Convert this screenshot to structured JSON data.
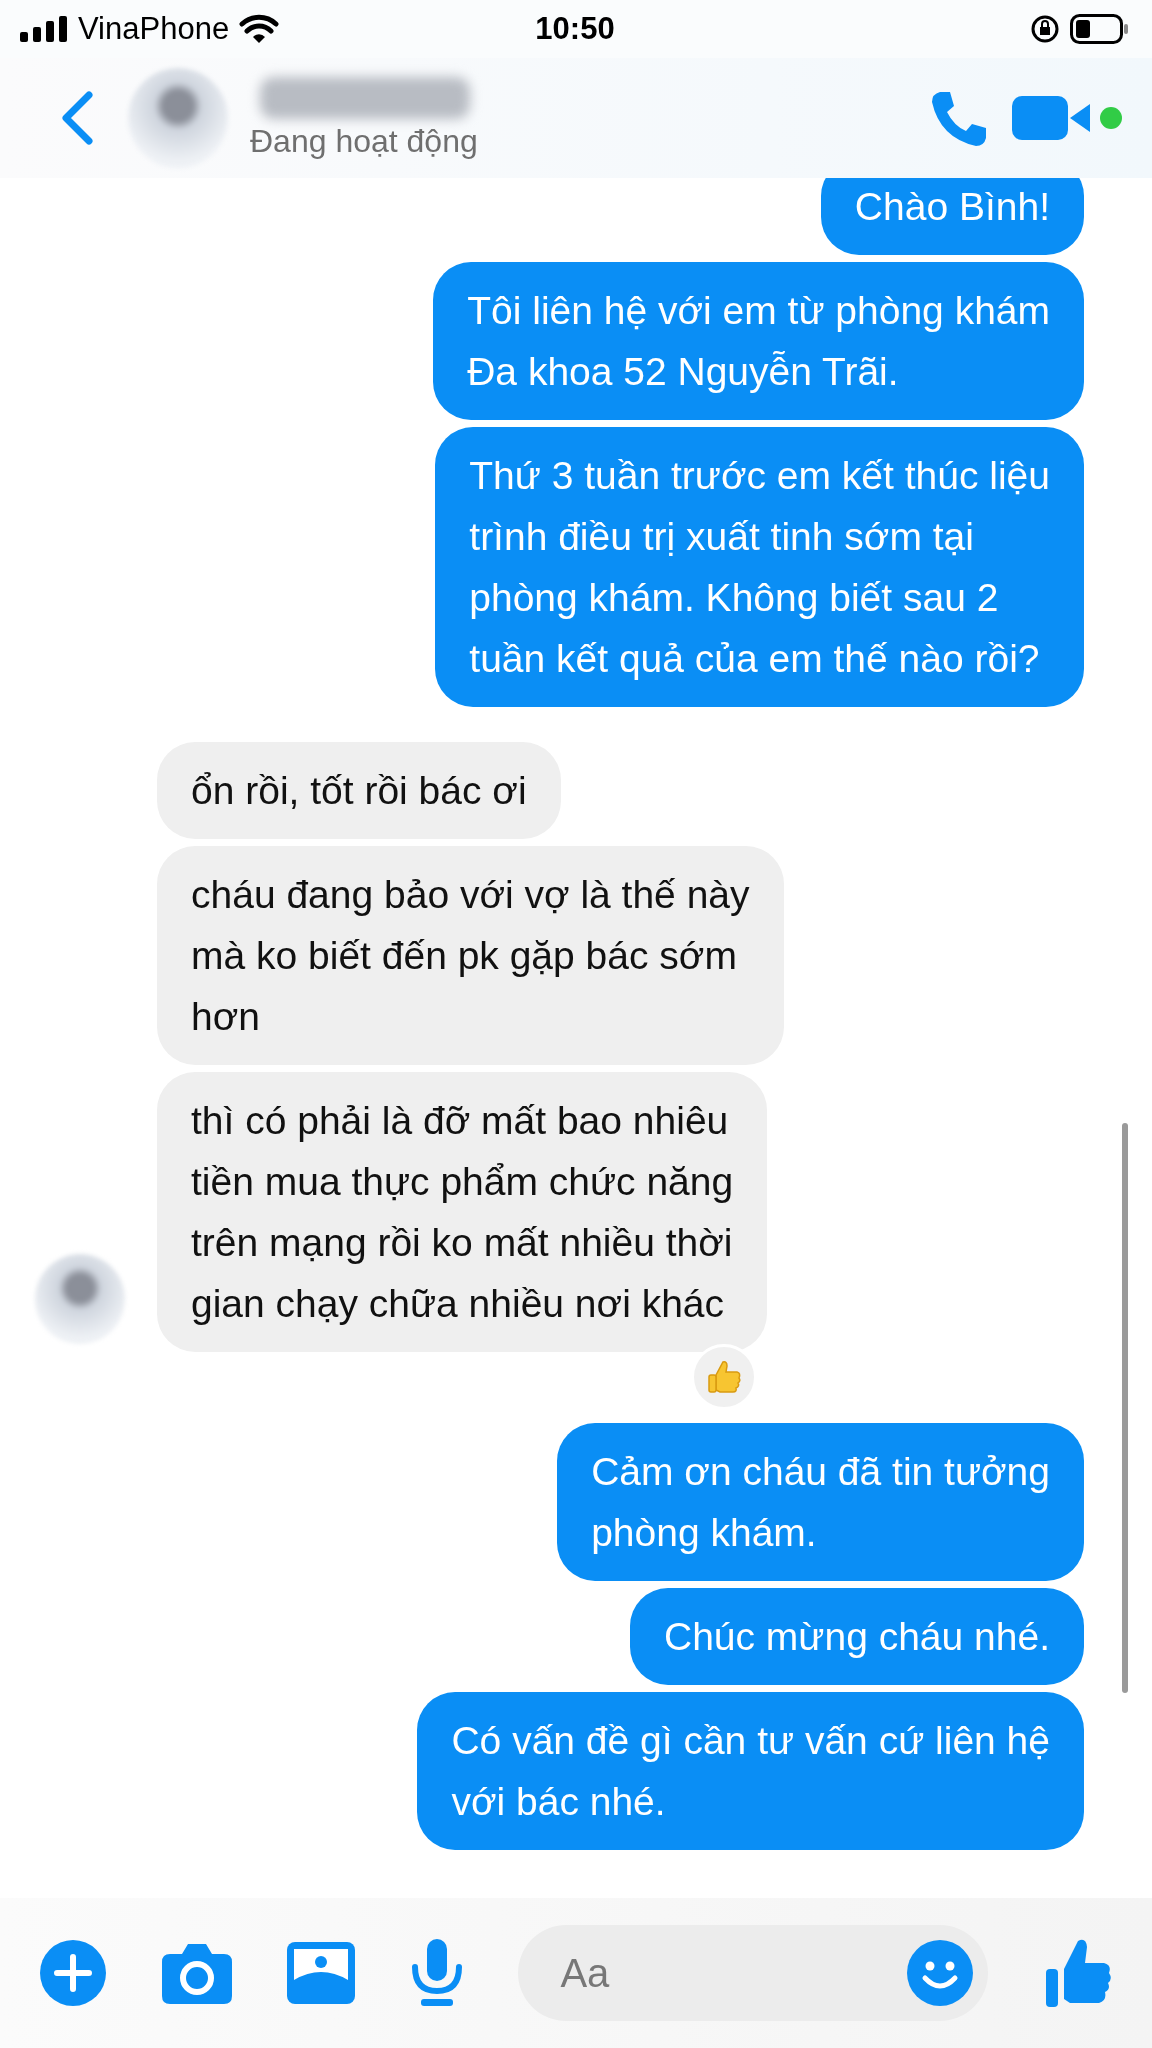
{
  "status_bar": {
    "carrier": "VinaPhone",
    "time": "10:50"
  },
  "header": {
    "presence": "Đang hoạt động"
  },
  "groups": [
    {
      "kind": "outgoing",
      "messages": [
        {
          "text": "Chào Bình!",
          "reacted": false
        },
        {
          "text": "Tôi liên hệ với em từ phòng khám\nĐa khoa 52 Nguyễn Trãi.",
          "reacted": false
        },
        {
          "text": "Thứ 3 tuần trước em kết thúc liệu\ntrình điều trị xuất tinh sớm tại\nphòng khám. Không biết sau 2\ntuần kết quả của em thế nào rồi?",
          "reacted": false
        }
      ]
    },
    {
      "kind": "incoming",
      "messages": [
        {
          "text": "ổn rồi, tốt rồi bác ơi",
          "reacted": false
        },
        {
          "text": "cháu đang bảo với vợ là thế này\nmà ko biết đến pk gặp bác sớm\nhơn",
          "reacted": false
        },
        {
          "text": "thì có phải là đỡ mất bao nhiêu\ntiền mua thực phẩm chức năng\ntrên mạng rồi ko mất nhiều thời\ngian chạy chữa nhiều nơi khác",
          "reacted": true
        }
      ]
    },
    {
      "kind": "outgoing",
      "messages": [
        {
          "text": "Cảm ơn cháu đã tin tưởng\nphòng khám.",
          "reacted": false
        },
        {
          "text": "Chúc mừng cháu nhé.",
          "reacted": false
        },
        {
          "text": "Có vấn đề gì cần tư vấn cứ liên hệ\nvới bác nhé.",
          "reacted": false
        }
      ]
    }
  ],
  "composer": {
    "placeholder": "Aa"
  }
}
